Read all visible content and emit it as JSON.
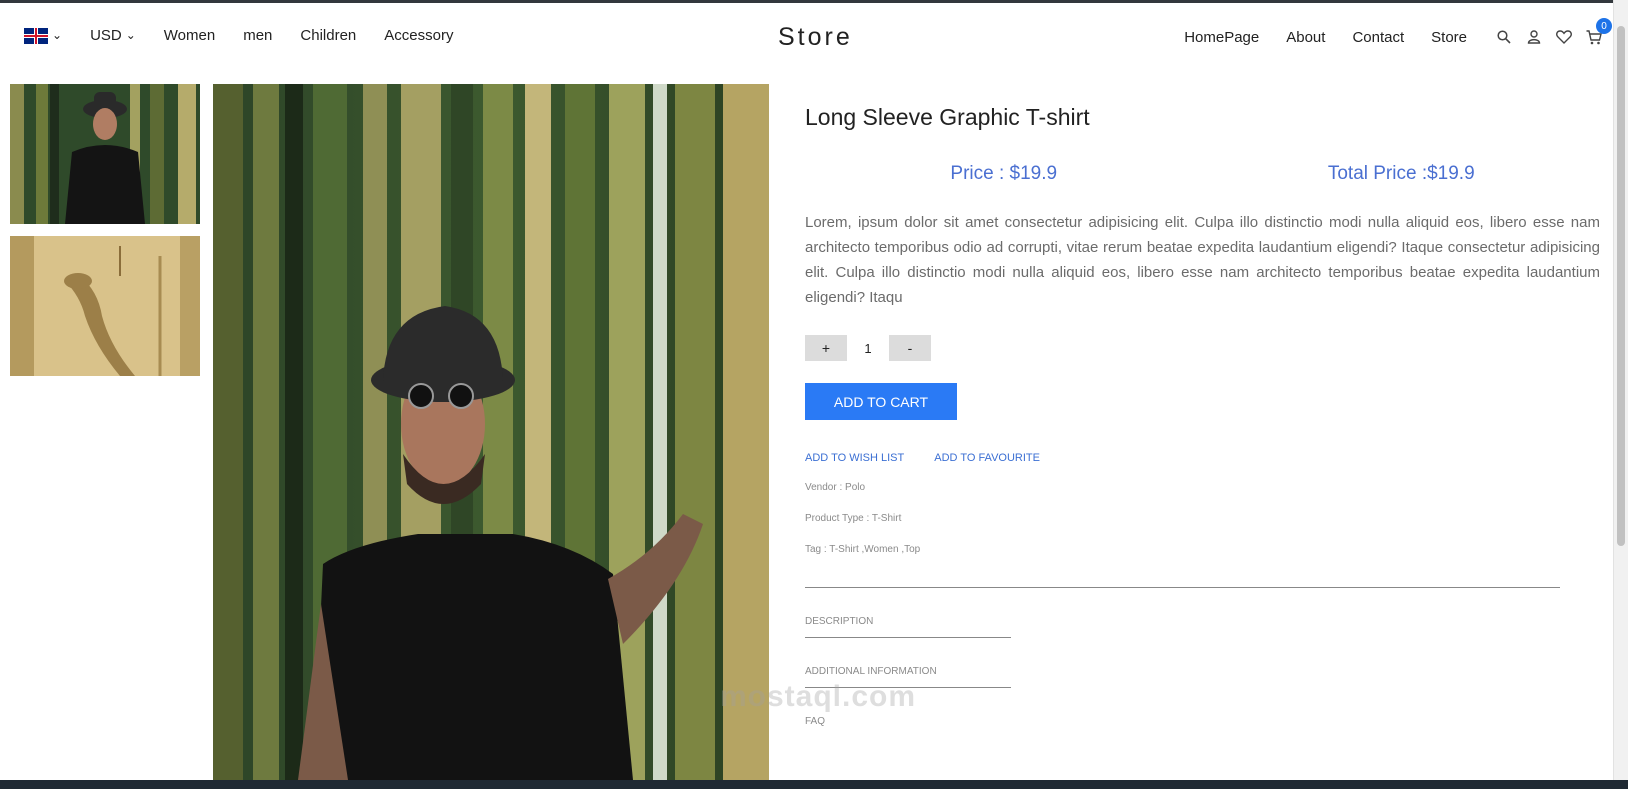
{
  "header": {
    "currency": "USD",
    "left_links": [
      "Women",
      "men",
      "Children",
      "Accessory"
    ],
    "brand": "Store",
    "right_links": [
      "HomePage",
      "About",
      "Contact",
      "Store"
    ],
    "cart_count": "0"
  },
  "product": {
    "title": "Long Sleeve Graphic T-shirt",
    "price_label": "Price : $19.9",
    "total_price_label": "Total Price :$19.9",
    "description": "Lorem, ipsum dolor sit amet consectetur adipisicing elit. Culpa illo distinctio modi nulla aliquid eos, libero esse nam architecto temporibus odio ad corrupti, vitae rerum beatae expedita laudantium eligendi? Itaque consectetur adipisicing elit. Culpa illo distinctio modi nulla aliquid eos, libero esse nam architecto temporibus beatae expedita laudantium eligendi? Itaqu",
    "quantity": "1",
    "plus": "+",
    "minus": "-",
    "add_to_cart": "ADD TO CART",
    "add_to_wishlist": "ADD TO WISH LIST",
    "add_to_favourite": "ADD TO FAVOURITE",
    "vendor": "Vendor : Polo",
    "product_type": "Product Type : T-Shirt",
    "tags": "Tag : T-Shirt ,Women ,Top"
  },
  "tabs": [
    "DESCRIPTION",
    "ADDITIONAL INFORMATION",
    "FAQ"
  ],
  "watermark": "mostaql.com",
  "colors": {
    "accent": "#2a7af5",
    "price": "#4a6fd1",
    "badge": "#1e73e8"
  }
}
